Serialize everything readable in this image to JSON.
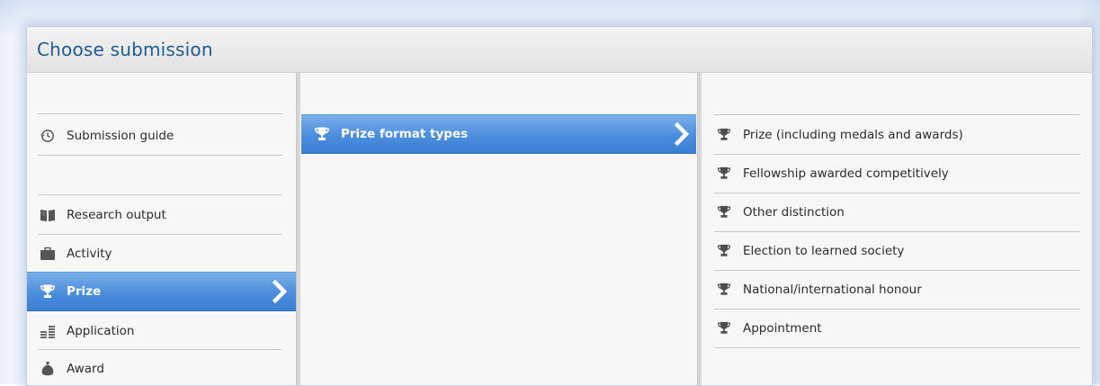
{
  "dialog": {
    "title": "Choose submission"
  },
  "column1": {
    "items": [
      {
        "label": "Submission guide",
        "icon": "history-icon",
        "selected": false
      },
      {
        "label": "Research output",
        "icon": "book-icon",
        "selected": false
      },
      {
        "label": "Activity",
        "icon": "briefcase-icon",
        "selected": false
      },
      {
        "label": "Prize",
        "icon": "trophy-icon",
        "selected": true
      },
      {
        "label": "Application",
        "icon": "coins-icon",
        "selected": false
      },
      {
        "label": "Award",
        "icon": "money-bag-icon",
        "selected": false
      }
    ]
  },
  "column2": {
    "items": [
      {
        "label": "Prize format types",
        "icon": "trophy-icon",
        "selected": true
      }
    ]
  },
  "column3": {
    "items": [
      {
        "label": "Prize (including medals and awards)",
        "icon": "trophy-icon"
      },
      {
        "label": "Fellowship awarded competitively",
        "icon": "trophy-icon"
      },
      {
        "label": "Other distinction",
        "icon": "trophy-icon"
      },
      {
        "label": "Election to learned society",
        "icon": "trophy-icon"
      },
      {
        "label": "National/international honour",
        "icon": "trophy-icon"
      },
      {
        "label": "Appointment",
        "icon": "trophy-icon"
      }
    ]
  },
  "colors": {
    "title": "#1f5b93",
    "selection": "#4c8ddd",
    "icon": "#4d4d4d"
  }
}
